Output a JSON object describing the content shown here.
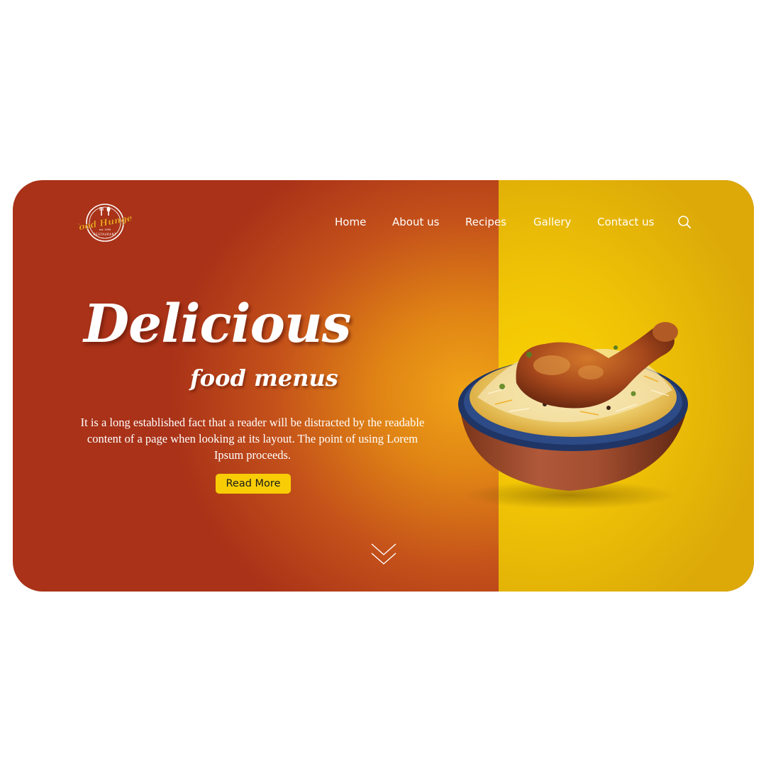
{
  "logo": {
    "brand_text": "Food Hunger",
    "established_text": "est. 1995",
    "tagline_text": "RESTAURANT"
  },
  "nav": {
    "items": [
      {
        "label": "Home"
      },
      {
        "label": "About us"
      },
      {
        "label": "Recipes"
      },
      {
        "label": "Gallery"
      },
      {
        "label": "Contact us"
      }
    ],
    "search_icon": "search-icon"
  },
  "hero": {
    "title": "Delicious",
    "subtitle": "food menus",
    "body": "It is a long established fact that a reader will be distracted by the readable content of a page when looking at its layout. The point of using Lorem Ipsum proceeds.",
    "button_label": "Read More",
    "scroll_icon": "double-chevron-down-icon",
    "image": "chicken-biryani-bowl"
  },
  "colors": {
    "left_bg": "#a93218",
    "glow": "#f0a316",
    "right_bg": "#f4c804",
    "button_bg": "#f8cd06",
    "text": "#ffffff"
  }
}
